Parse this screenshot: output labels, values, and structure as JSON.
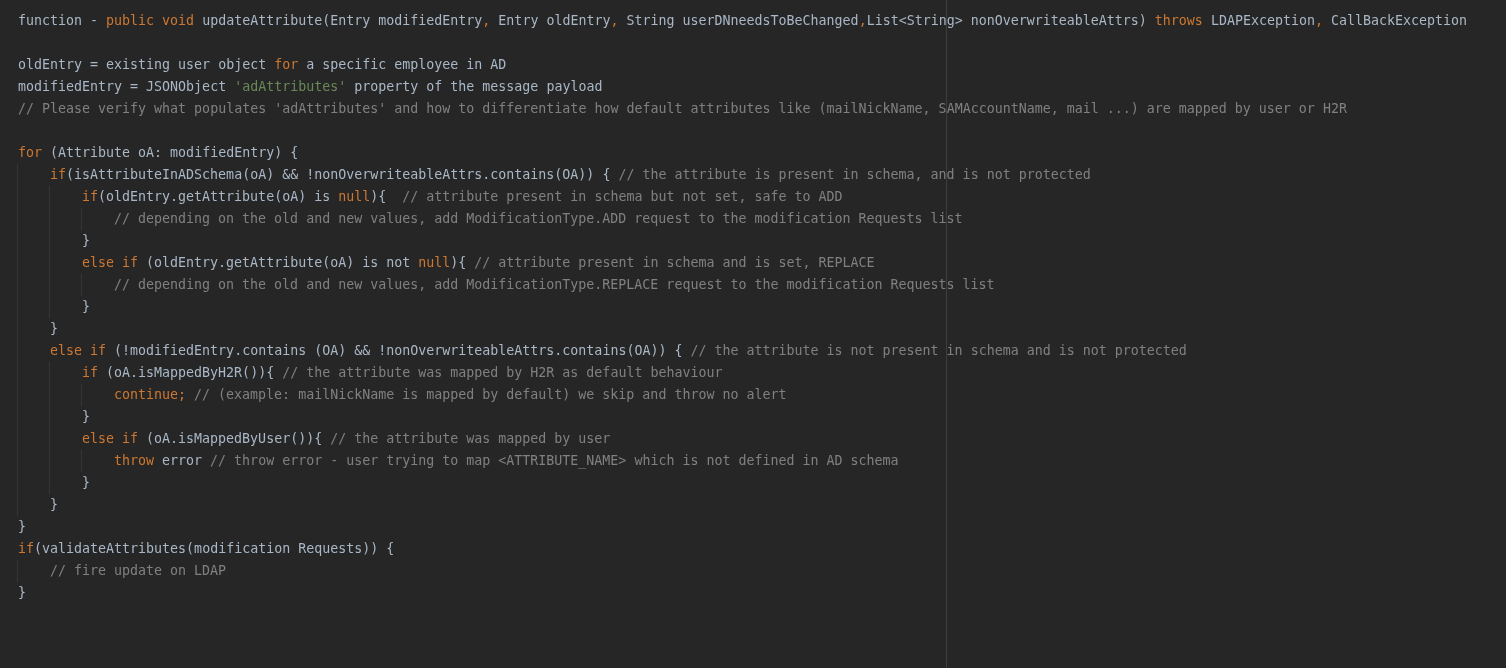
{
  "editor": {
    "lines": [
      {
        "kind": "code",
        "tokens": [
          {
            "kind": "plain",
            "text": "function - "
          },
          {
            "kind": "keyword",
            "text": "public void "
          },
          {
            "kind": "plain",
            "text": "updateAttribute(Entry modifiedEntry",
            "separator": ", "
          },
          {
            "kind": "plain",
            "text": "Entry oldEntry",
            "separator": ", "
          },
          {
            "kind": "plain",
            "text": "String userDNneedsToBeChanged",
            "separator": ","
          },
          {
            "kind": "plain",
            "text": "List<String> nonOverwriteableAttrs) "
          },
          {
            "kind": "keyword",
            "text": "throws "
          },
          {
            "kind": "plain",
            "text": "LDAPException",
            "separator": ", "
          },
          {
            "kind": "plain",
            "text": "CallBackException"
          }
        ]
      },
      {
        "kind": "blank"
      },
      {
        "kind": "code",
        "tokens": [
          {
            "kind": "plain",
            "text": "oldEntry = existing user object "
          },
          {
            "kind": "keyword",
            "text": "for "
          },
          {
            "kind": "plain",
            "text": "a specific employee in AD"
          }
        ]
      },
      {
        "kind": "code",
        "tokens": [
          {
            "kind": "plain",
            "text": "modifiedEntry = JSONObject "
          },
          {
            "kind": "string",
            "text": "'adAttributes' "
          },
          {
            "kind": "plain",
            "text": "property of the message payload"
          }
        ]
      },
      {
        "kind": "code",
        "tokens": [
          {
            "kind": "comment",
            "text": "// Please verify what populates 'adAttributes' and how to differentiate how default attributes like (mailNickName, SAMAccountName, mail ...) are mapped by user or H2R"
          }
        ]
      },
      {
        "kind": "blank"
      },
      {
        "kind": "code",
        "tokens": [
          {
            "kind": "keyword",
            "text": "for "
          },
          {
            "kind": "plain",
            "text": "(Attribute oA: modifiedEntry) {"
          }
        ],
        "children": [
          {
            "kind": "code",
            "tokens": [
              {
                "kind": "keyword",
                "text": "if"
              },
              {
                "kind": "plain",
                "text": "(isAttributeInADSchema(oA) && !nonOverwriteableAttrs.contains(OA)) { "
              },
              {
                "kind": "comment",
                "text": "// the attribute is present in schema, and is not protected"
              }
            ],
            "children": [
              {
                "kind": "code",
                "tokens": [
                  {
                    "kind": "keyword",
                    "text": "if"
                  },
                  {
                    "kind": "plain",
                    "text": "(oldEntry.getAttribute(oA) is "
                  },
                  {
                    "kind": "keyword",
                    "text": "null"
                  },
                  {
                    "kind": "plain",
                    "text": "){  "
                  },
                  {
                    "kind": "comment",
                    "text": "// attribute present in schema but not set, safe to ADD"
                  }
                ],
                "children": [
                  {
                    "kind": "code",
                    "tokens": [
                      {
                        "kind": "comment",
                        "text": "// depending on the old and new values, add ModificationType.ADD request to the modification Requests list"
                      }
                    ]
                  }
                ]
              },
              {
                "kind": "code",
                "tokens": [
                  {
                    "kind": "plain",
                    "text": "}"
                  }
                ]
              },
              {
                "kind": "code",
                "tokens": [
                  {
                    "kind": "keyword",
                    "text": "else if "
                  },
                  {
                    "kind": "plain",
                    "text": "(oldEntry.getAttribute(oA) is not "
                  },
                  {
                    "kind": "keyword",
                    "text": "null"
                  },
                  {
                    "kind": "plain",
                    "text": "){ "
                  },
                  {
                    "kind": "comment",
                    "text": "// attribute present in schema and is set, REPLACE"
                  }
                ],
                "children": [
                  {
                    "kind": "code",
                    "tokens": [
                      {
                        "kind": "comment",
                        "text": "// depending on the old and new values, add ModificationType.REPLACE request to the modification Requests list"
                      }
                    ]
                  }
                ]
              },
              {
                "kind": "code",
                "tokens": [
                  {
                    "kind": "plain",
                    "text": "}"
                  }
                ]
              }
            ]
          },
          {
            "kind": "code",
            "tokens": [
              {
                "kind": "plain",
                "text": "}"
              }
            ]
          },
          {
            "kind": "code",
            "tokens": [
              {
                "kind": "keyword",
                "text": "else if "
              },
              {
                "kind": "plain",
                "text": "(!modifiedEntry.contains (OA) && !nonOverwriteableAttrs.contains(OA)) { "
              },
              {
                "kind": "comment",
                "text": "// the attribute is not present in schema and is not protected"
              }
            ],
            "children": [
              {
                "kind": "code",
                "tokens": [
                  {
                    "kind": "keyword",
                    "text": "if "
                  },
                  {
                    "kind": "plain",
                    "text": "(oA.isMappedByH2R()){ "
                  },
                  {
                    "kind": "comment",
                    "text": "// the attribute was mapped by H2R as default behaviour"
                  }
                ],
                "children": [
                  {
                    "kind": "code",
                    "tokens": [
                      {
                        "kind": "keyword",
                        "text": "continue; "
                      },
                      {
                        "kind": "comment",
                        "text": "// (example: mailNickName is mapped by default) we skip and throw no alert"
                      }
                    ]
                  }
                ]
              },
              {
                "kind": "code",
                "tokens": [
                  {
                    "kind": "plain",
                    "text": "}"
                  }
                ]
              },
              {
                "kind": "code",
                "tokens": [
                  {
                    "kind": "keyword",
                    "text": "else if "
                  },
                  {
                    "kind": "plain",
                    "text": "(oA.isMappedByUser()){ "
                  },
                  {
                    "kind": "comment",
                    "text": "// the attribute was mapped by user"
                  }
                ],
                "children": [
                  {
                    "kind": "code",
                    "tokens": [
                      {
                        "kind": "keyword",
                        "text": "throw "
                      },
                      {
                        "kind": "plain",
                        "text": "error "
                      },
                      {
                        "kind": "comment",
                        "text": "// throw error - user trying to map <ATTRIBUTE_NAME> which is not defined in AD schema"
                      }
                    ]
                  }
                ]
              },
              {
                "kind": "code",
                "tokens": [
                  {
                    "kind": "plain",
                    "text": "}"
                  }
                ]
              }
            ]
          },
          {
            "kind": "code",
            "tokens": [
              {
                "kind": "plain",
                "text": "}"
              }
            ]
          }
        ]
      },
      {
        "kind": "code",
        "tokens": [
          {
            "kind": "plain",
            "text": "}"
          }
        ]
      },
      {
        "kind": "code",
        "tokens": [
          {
            "kind": "keyword",
            "text": "if"
          },
          {
            "kind": "plain",
            "text": "(validateAttributes(modification Requests)) {"
          }
        ],
        "children": [
          {
            "kind": "code",
            "tokens": [
              {
                "kind": "comment",
                "text": "// fire update on LDAP"
              }
            ]
          }
        ]
      },
      {
        "kind": "code",
        "tokens": [
          {
            "kind": "plain",
            "text": "}"
          }
        ]
      }
    ]
  }
}
